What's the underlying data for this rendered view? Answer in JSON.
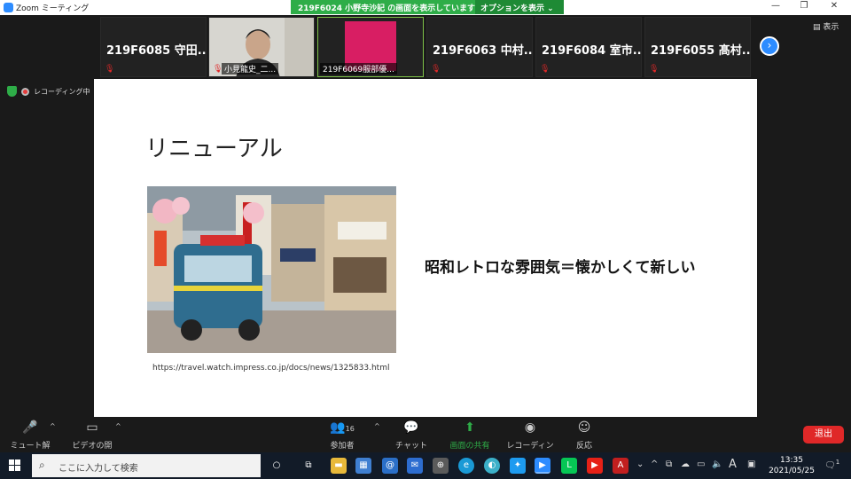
{
  "window": {
    "app_title": "Zoom ミーティング",
    "share_message": "219F6024 小野寺沙記 の画面を表示しています",
    "options_label": "オプションを表示",
    "minimize": "—",
    "restore": "❐",
    "close": "✕"
  },
  "participants": [
    {
      "name": "219F6085 守田...",
      "muted": true
    },
    {
      "name": "小見龍史_二...",
      "muted": true,
      "video": true
    },
    {
      "name": "219F6069服部優...",
      "muted": false,
      "video": true,
      "active": true
    },
    {
      "name": "219F6063 中村...",
      "muted": true
    },
    {
      "name": "219F6084 室市...",
      "muted": true
    },
    {
      "name": "219F6055 髙村...",
      "muted": true
    }
  ],
  "view_label": "表示",
  "recording_label": "レコーディング中",
  "slide": {
    "title": "リニューアル",
    "image_caption": "https://travel.watch.impress.co.jp/docs/news/1325833.html",
    "headline": "昭和レトロな雰囲気＝懐かしくて新しい"
  },
  "controls": {
    "unmute": "ミュート解除",
    "start_video": "ビデオの開始",
    "participants": "参加者",
    "participant_count": "16",
    "chat": "チャット",
    "share_screen": "画面の共有",
    "recording": "レコーディング",
    "reactions": "反応",
    "leave": "退出"
  },
  "taskbar": {
    "search_placeholder": "ここに入力して検索",
    "time": "13:35",
    "date": "2021/05/25",
    "ime": "A",
    "notifications": "1"
  },
  "colors": {
    "accent": "#2d8cff",
    "share_green": "#2ead48",
    "leave_red": "#e02828",
    "taskbar": "#121b28"
  }
}
